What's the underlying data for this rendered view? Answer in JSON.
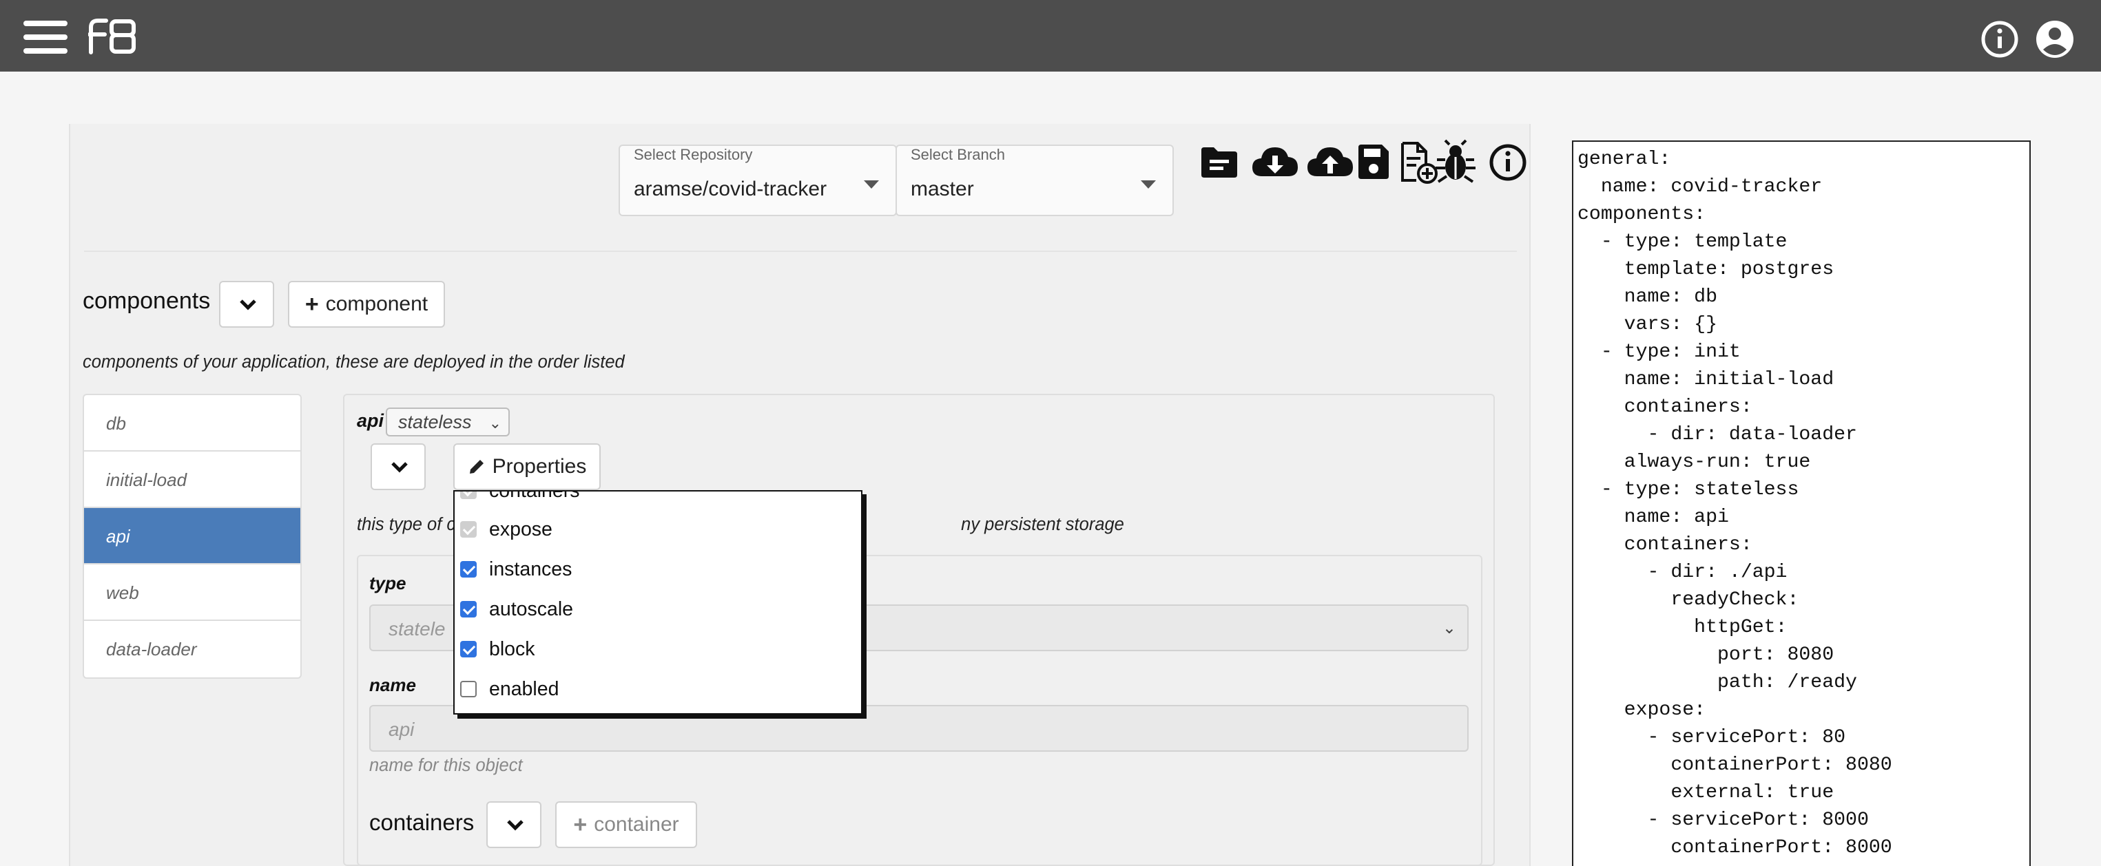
{
  "app": {
    "logo_text": "f8",
    "menu_icon": "hamburger-menu-icon",
    "info_icon": "info-circle-icon",
    "user_icon": "account-circle-icon"
  },
  "repo": {
    "label": "Select Repository",
    "value": "aramse/covid-tracker"
  },
  "branch": {
    "label": "Select Branch",
    "value": "master"
  },
  "toolbar_icons": [
    "folder-icon",
    "cloud-download-icon",
    "cloud-upload-icon",
    "save-icon",
    "new-file-icon",
    "bug-icon",
    "info-icon"
  ],
  "components": {
    "title": "components",
    "add_label": "component",
    "description": "components of your application, these are deployed in the order listed",
    "items": [
      {
        "label": "db",
        "active": false
      },
      {
        "label": "initial-load",
        "active": false
      },
      {
        "label": "api",
        "active": true
      },
      {
        "label": "web",
        "active": false
      },
      {
        "label": "data-loader",
        "active": false
      }
    ]
  },
  "detail": {
    "name": "api",
    "type_value": "stateless",
    "properties_label": "Properties",
    "description_left": "this type of c",
    "description_right": "ny persistent storage",
    "type_field_label": "type",
    "type_field_value": "statele",
    "name_field_label": "name",
    "name_field_value": "api",
    "name_help": "name for this object",
    "containers_title": "containers",
    "add_container_label": "container"
  },
  "properties_dropdown": [
    {
      "label": "containers",
      "state": "disabled"
    },
    {
      "label": "expose",
      "state": "disabled"
    },
    {
      "label": "instances",
      "state": "checked"
    },
    {
      "label": "autoscale",
      "state": "checked"
    },
    {
      "label": "block",
      "state": "checked"
    },
    {
      "label": "enabled",
      "state": "unchecked"
    }
  ],
  "yaml_text": "general:\n  name: covid-tracker\ncomponents:\n  - type: template\n    template: postgres\n    name: db\n    vars: {}\n  - type: init\n    name: initial-load\n    containers:\n      - dir: data-loader\n    always-run: true\n  - type: stateless\n    name: api\n    containers:\n      - dir: ./api\n        readyCheck:\n          httpGet:\n            port: 8080\n            path: /ready\n    expose:\n      - servicePort: 80\n        containerPort: 8080\n        external: true\n      - servicePort: 8000\n        containerPort: 8000"
}
